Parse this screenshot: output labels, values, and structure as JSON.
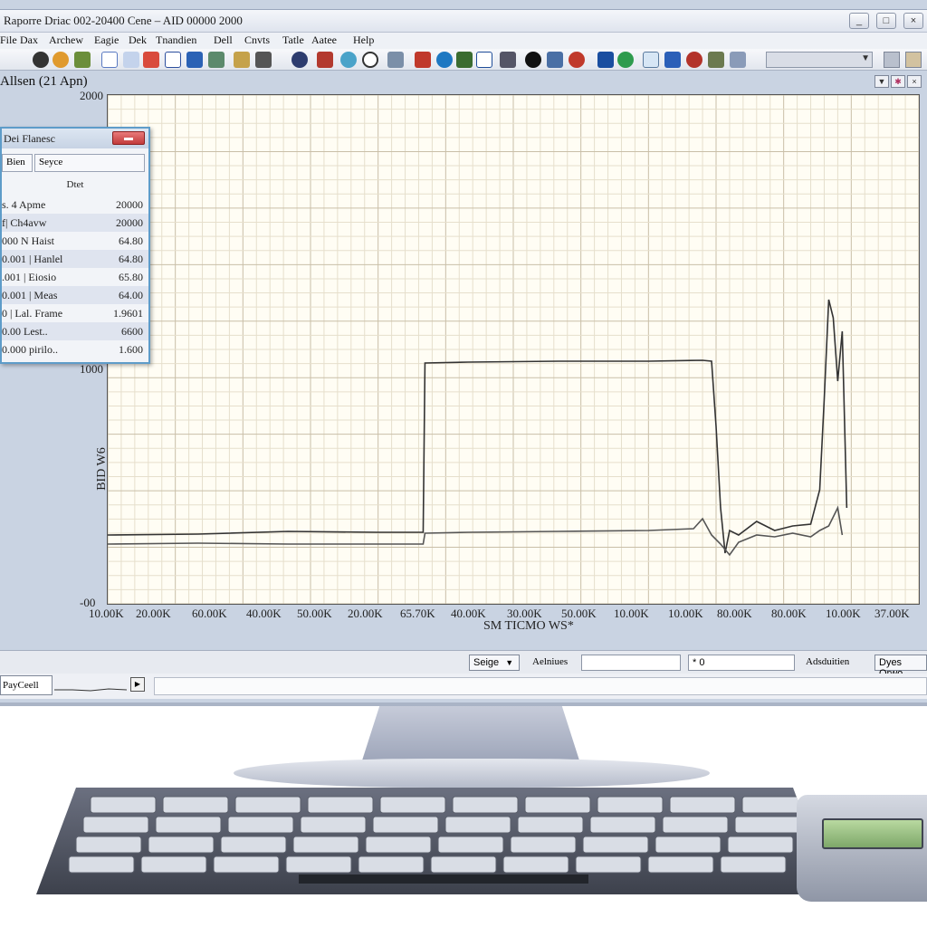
{
  "window": {
    "title": "Raporre Driac 002-20400 Cene – AID 00000 2000",
    "buttons": [
      "",
      "",
      ""
    ]
  },
  "menu": [
    "File",
    "Dax",
    "Archew",
    "Eagie",
    "Dek",
    "Tnandien",
    "Dell",
    "Cnvts",
    "Tatle",
    "Aatee",
    "Help"
  ],
  "toolbar": {
    "dropdown_value": ""
  },
  "chart": {
    "title": "Allsen (21 Apn)"
  },
  "panel": {
    "title": "Dei Flanesc",
    "close_label": "",
    "tabs": [
      "Bien",
      "Seyce"
    ],
    "column_header": "Dtet",
    "rows": [
      {
        "label": "s. 4 Apme",
        "value": "20000"
      },
      {
        "label": "f| Ch4avw",
        "value": "20000"
      },
      {
        "label": "000 N Haist",
        "value": "64.80"
      },
      {
        "label": "0.001 | Hanlel",
        "value": "64.80"
      },
      {
        "label": ".001 | Eiosio",
        "value": "65.80"
      },
      {
        "label": "0.001 | Meas",
        "value": "64.00"
      },
      {
        "label": "0 | Lal. Frame",
        "value": "1.9601"
      },
      {
        "label": "0.00 Lest..",
        "value": "6600"
      },
      {
        "label": "0.000 pirilo..",
        "value": "1.600"
      }
    ]
  },
  "status": {
    "dropdown_label": "Seige",
    "field_label": "Aelniues",
    "value_field": "* 0",
    "label2": "Adsduitien",
    "dropdown2_label": "Dyes Orwo"
  },
  "bottom": {
    "tab_label": "PayCeell"
  },
  "chart_data": {
    "type": "line",
    "title": "Allsen (21 Apn)",
    "xlabel": "SM TICMO WS*",
    "ylabel": "BID W6",
    "y_tick_labels": [
      "2000",
      "1000",
      "-00"
    ],
    "x_tick_labels": [
      "10.00K",
      "20.00K",
      "60.00K",
      "40.00K",
      "50.00K",
      "20.00K",
      "65.70K",
      "40.00K",
      "30.00K",
      "50.00K",
      "10.00K",
      "10.00K",
      "80.00K",
      "80.00K",
      "10.00K",
      "37.00K"
    ],
    "grid": true,
    "series": [
      {
        "values": [
          [
            0,
            590
          ],
          [
            100,
            589
          ],
          [
            200,
            586
          ],
          [
            300,
            587
          ],
          [
            350,
            587
          ],
          [
            352,
            400
          ],
          [
            400,
            399
          ],
          [
            500,
            398
          ],
          [
            600,
            398
          ],
          [
            660,
            397
          ],
          [
            670,
            398
          ],
          [
            675,
            470
          ],
          [
            680,
            560
          ],
          [
            685,
            610
          ],
          [
            690,
            585
          ],
          [
            700,
            590
          ],
          [
            720,
            575
          ],
          [
            740,
            585
          ],
          [
            760,
            580
          ],
          [
            780,
            578
          ],
          [
            790,
            540
          ],
          [
            795,
            440
          ],
          [
            800,
            330
          ],
          [
            805,
            350
          ],
          [
            810,
            420
          ],
          [
            815,
            365
          ],
          [
            820,
            560
          ]
        ]
      },
      {
        "values": [
          [
            0,
            600
          ],
          [
            100,
            599
          ],
          [
            200,
            600
          ],
          [
            300,
            600
          ],
          [
            350,
            600
          ],
          [
            352,
            588
          ],
          [
            400,
            587
          ],
          [
            500,
            586
          ],
          [
            600,
            585
          ],
          [
            650,
            583
          ],
          [
            660,
            572
          ],
          [
            670,
            590
          ],
          [
            680,
            600
          ],
          [
            690,
            612
          ],
          [
            700,
            598
          ],
          [
            720,
            590
          ],
          [
            740,
            592
          ],
          [
            760,
            588
          ],
          [
            780,
            592
          ],
          [
            790,
            585
          ],
          [
            800,
            580
          ],
          [
            810,
            560
          ],
          [
            815,
            590
          ]
        ]
      }
    ]
  }
}
